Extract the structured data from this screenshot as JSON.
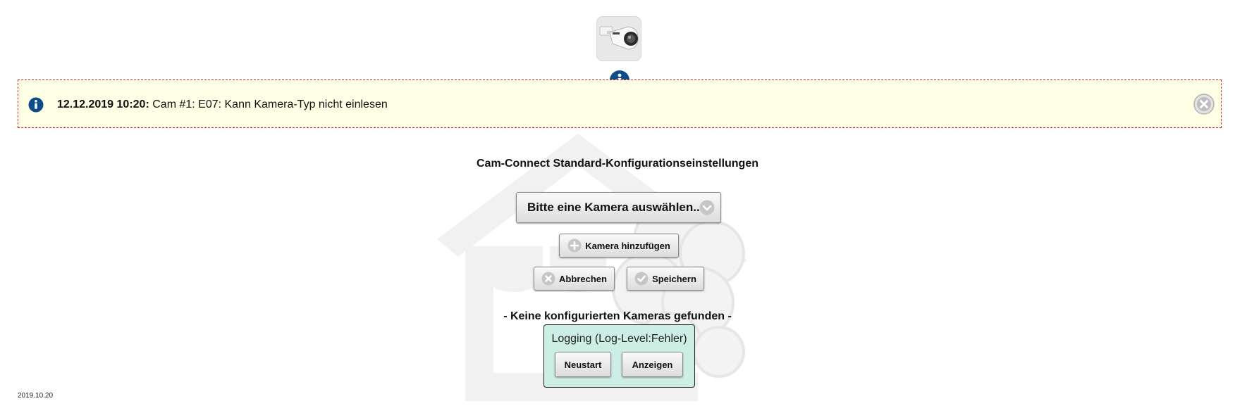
{
  "header": {
    "logo_icon": "security-camera-icon",
    "info_icon": "info-circle-icon"
  },
  "notice": {
    "timestamp": "12.12.2019 10:20:",
    "message": "Cam #1: E07: Kann Kamera-Typ nicht einlesen",
    "icon": "info-circle-icon",
    "close_icon": "close-circle-icon",
    "border_color": "#e02020",
    "background": "#ffffe6"
  },
  "main": {
    "title": "Cam-Connect Standard-Konfigurationseinstellungen",
    "camera_select": {
      "label": "Bitte eine Kamera auswählen...",
      "icon": "chevron-down-circle-icon"
    },
    "add_camera_label": "Kamera hinzufügen",
    "cancel_label": "Abbrechen",
    "save_label": "Speichern",
    "no_cameras_text": "- Keine konfigurierten Kameras gefunden -"
  },
  "logging": {
    "title": "Logging (Log-Level:Fehler)",
    "restart_label": "Neustart",
    "show_label": "Anzeigen",
    "background": "#cdeee4"
  },
  "footer": {
    "version": "2019.10.20"
  },
  "colors": {
    "info_blue": "#0f4c8a",
    "icon_gray": "#bdbdbd"
  }
}
